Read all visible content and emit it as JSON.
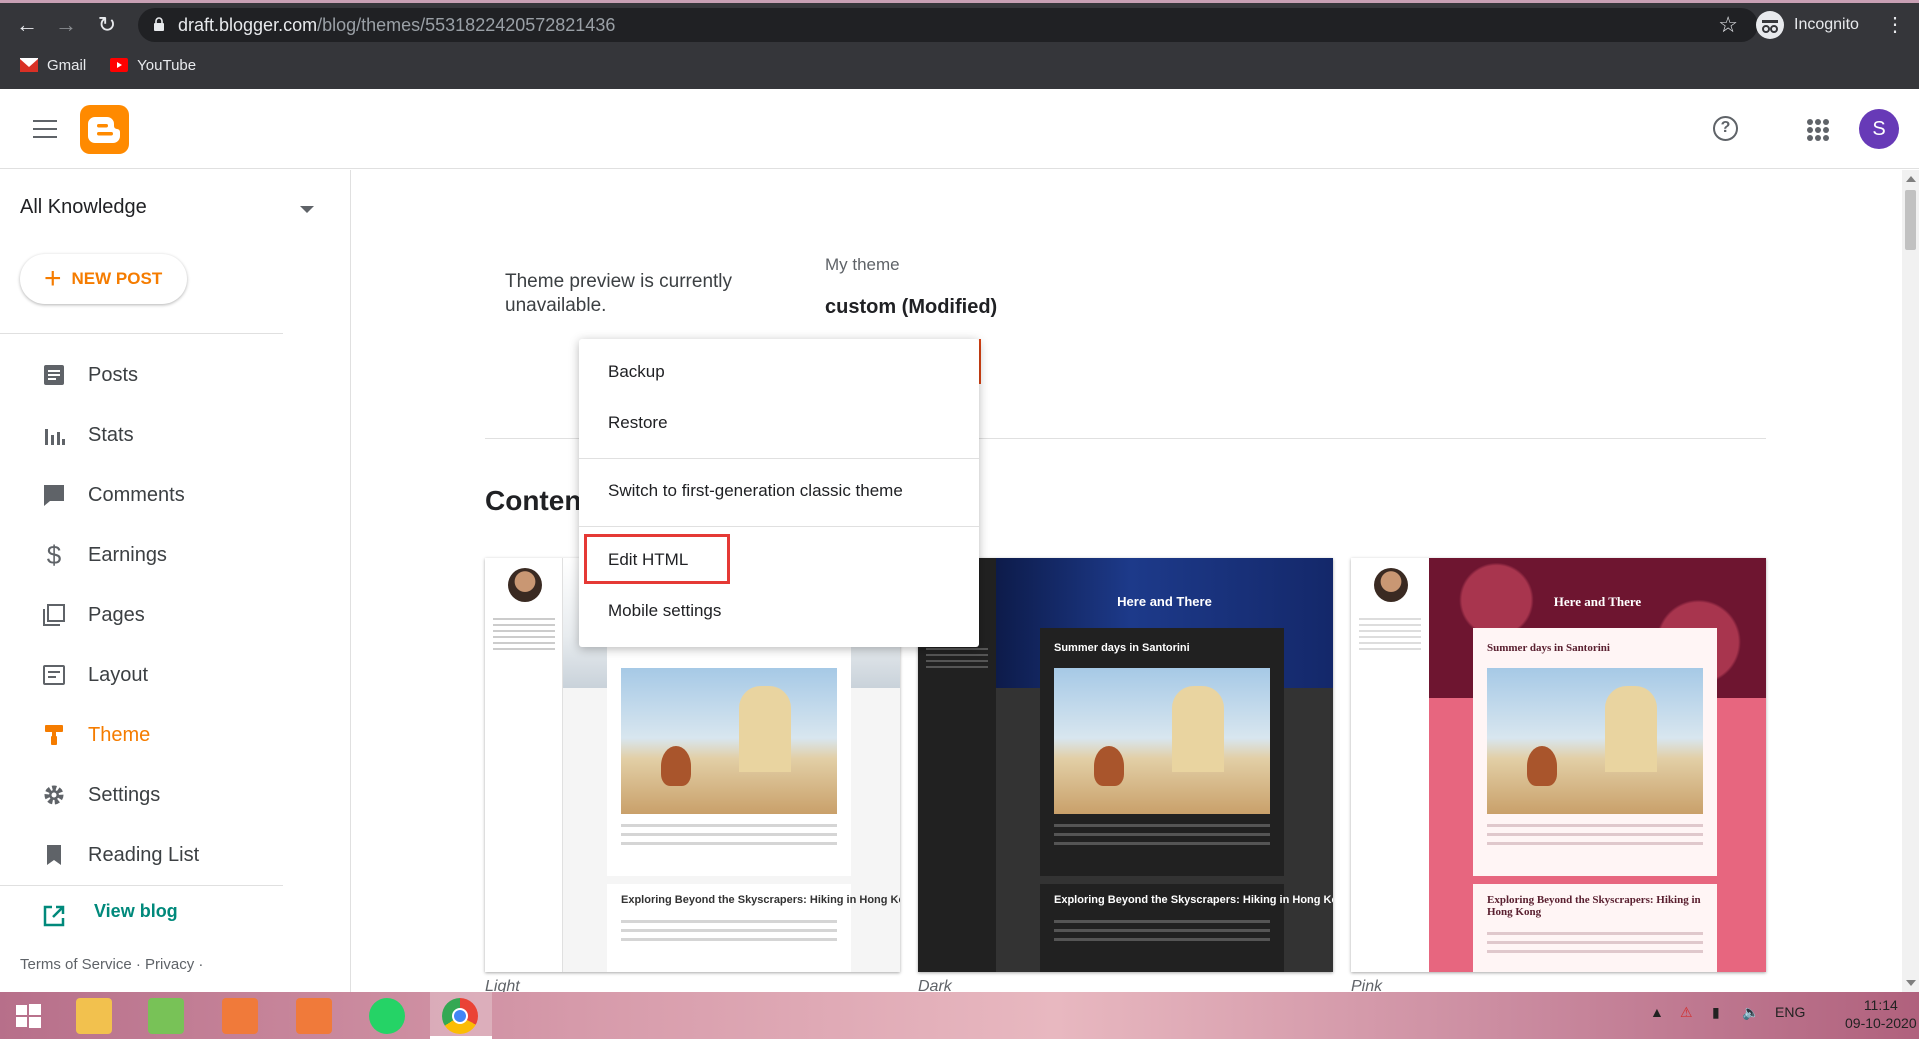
{
  "browser": {
    "url_host": "draft.blogger.com",
    "url_path": "/blog/themes/5531822420572821436",
    "profile_label": "Incognito",
    "bookmarks": [
      {
        "label": "Gmail",
        "icon": "gmail-icon",
        "color": "#d93025"
      },
      {
        "label": "YouTube",
        "icon": "youtube-icon",
        "color": "#ff0000"
      }
    ]
  },
  "header": {
    "avatar_letter": "S",
    "brand_color": "#ff8a00"
  },
  "sidebar": {
    "blog_name": "All Knowledge",
    "new_post_label": "NEW POST",
    "items": [
      {
        "label": "Posts",
        "icon": "posts-icon"
      },
      {
        "label": "Stats",
        "icon": "stats-icon"
      },
      {
        "label": "Comments",
        "icon": "comments-icon"
      },
      {
        "label": "Earnings",
        "icon": "earnings-icon"
      },
      {
        "label": "Pages",
        "icon": "pages-icon"
      },
      {
        "label": "Layout",
        "icon": "layout-icon"
      },
      {
        "label": "Theme",
        "icon": "theme-icon",
        "active": true
      },
      {
        "label": "Settings",
        "icon": "settings-icon"
      },
      {
        "label": "Reading List",
        "icon": "reading-list-icon"
      }
    ],
    "view_blog_label": "View blog",
    "footer": {
      "terms": "Terms of Service",
      "privacy": "Privacy",
      "dot": "·"
    },
    "accent_color": "#f57c00"
  },
  "main": {
    "preview_message": "Theme preview is currently unavailable.",
    "my_theme_label": "My theme",
    "theme_name": "custom (Modified)",
    "section_heading": "Conten",
    "thumbnails": [
      {
        "label": "Light",
        "banner": "",
        "post_title": "",
        "post2_title": "Exploring Beyond the Skyscrapers: Hiking in Hong Kong"
      },
      {
        "label": "Dark",
        "banner": "Here and There",
        "post_title": "Summer days in Santorini",
        "post2_title": "Exploring Beyond the Skyscrapers: Hiking in Hong Kong"
      },
      {
        "label": "Pink",
        "banner": "Here and There",
        "post_title": "Summer days in Santorini",
        "post2_title": "Exploring Beyond the Skyscrapers: Hiking in Hong Kong"
      }
    ]
  },
  "menu": {
    "items": [
      {
        "label": "Backup"
      },
      {
        "label": "Restore"
      },
      {
        "label": "Switch to first-generation classic theme"
      },
      {
        "label": "Edit HTML",
        "highlighted": true
      },
      {
        "label": "Mobile settings"
      }
    ]
  },
  "taskbar": {
    "language": "ENG",
    "time": "11:14",
    "date": "09-10-2020"
  }
}
